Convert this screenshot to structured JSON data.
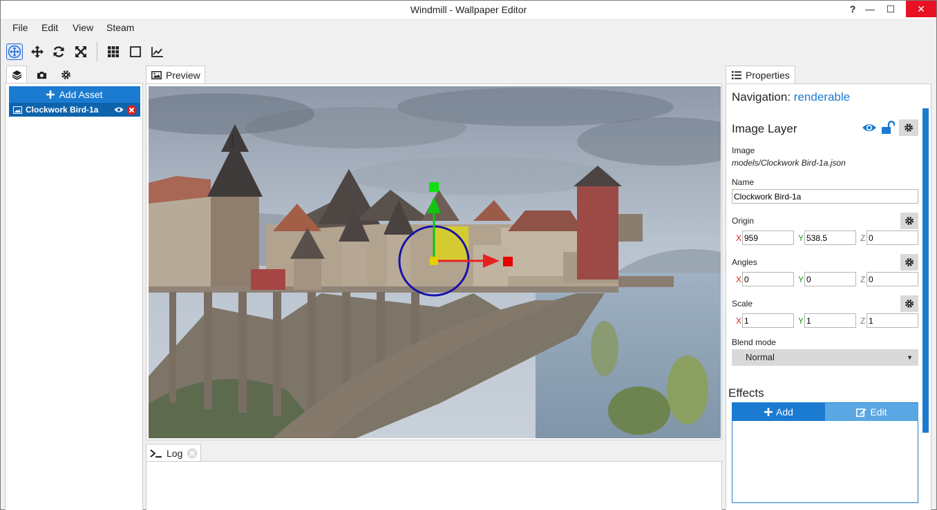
{
  "window": {
    "title": "Windmill - Wallpaper Editor",
    "help": "?",
    "minimize": "—",
    "maximize": "☐",
    "close": "✕"
  },
  "menu": [
    "File",
    "Edit",
    "View",
    "Steam"
  ],
  "toolbar": {
    "icons": [
      "move-gizmo-icon",
      "translate-icon",
      "rotate-icon",
      "scale-icon",
      "grid-icon",
      "square-icon",
      "chart-icon"
    ]
  },
  "left": {
    "tabs": [
      "layers-icon",
      "camera-icon",
      "gear-icon"
    ],
    "add_asset": "Add Asset",
    "asset": {
      "label": "Clockwork Bird-1a"
    }
  },
  "preview": {
    "tab": "Preview"
  },
  "log": {
    "tab": "Log"
  },
  "properties": {
    "tab": "Properties",
    "nav_label": "Navigation:",
    "nav_value": "renderable",
    "layer_title": "Image Layer",
    "image_label": "Image",
    "image_path": "models/Clockwork Bird-1a.json",
    "name_label": "Name",
    "name_value": "Clockwork Bird-1a",
    "origin_label": "Origin",
    "origin": {
      "x": "959",
      "y": "538.5",
      "z": "0"
    },
    "angles_label": "Angles",
    "angles": {
      "x": "0",
      "y": "0",
      "z": "0"
    },
    "scale_label": "Scale",
    "scale": {
      "x": "1",
      "y": "1",
      "z": "1"
    },
    "blend_label": "Blend mode",
    "blend_value": "Normal",
    "effects_label": "Effects",
    "effects_add": "Add",
    "effects_edit": "Edit",
    "axis": {
      "x": "X",
      "y": "Y",
      "z": "Z"
    }
  },
  "colors": {
    "accent": "#1a7bd1",
    "selected": "#0e63ad",
    "close": "#e81123"
  }
}
